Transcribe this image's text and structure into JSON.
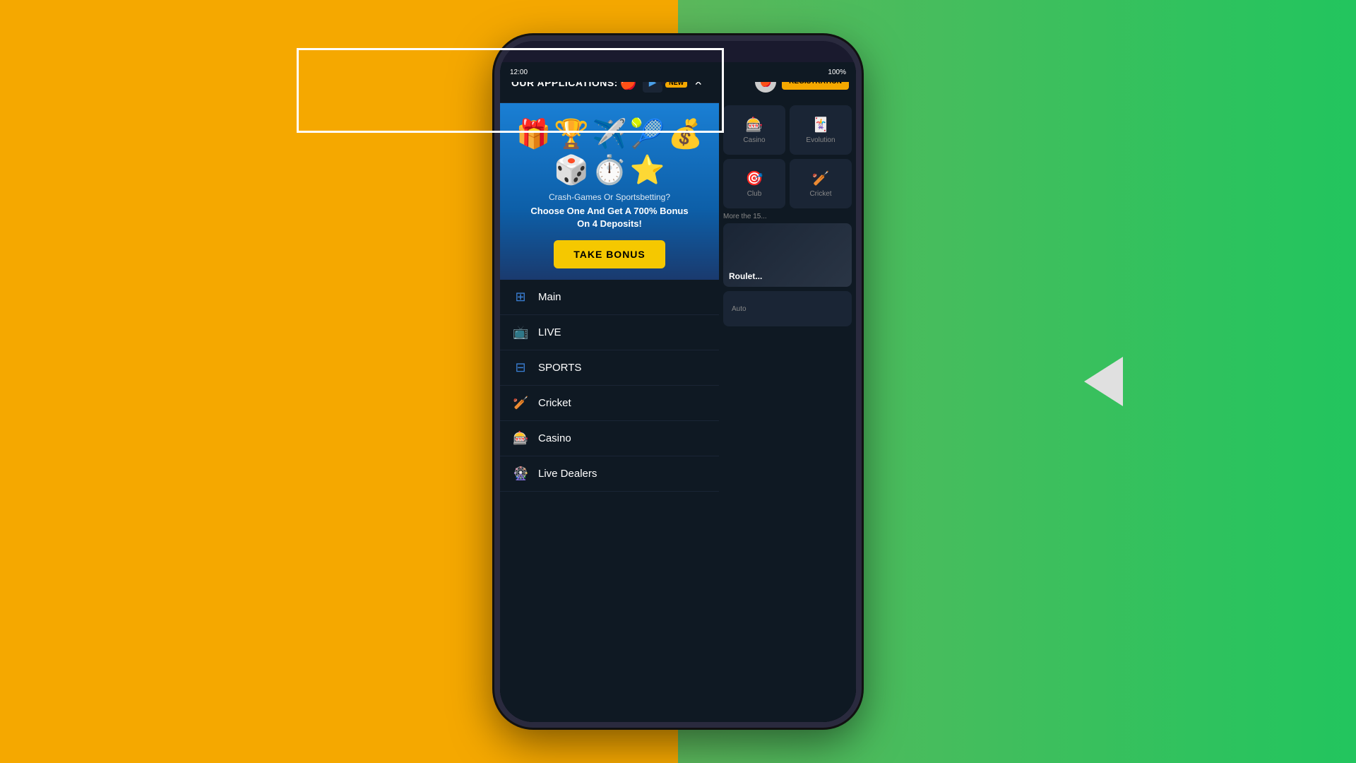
{
  "background": {
    "left_color": "#f5a800",
    "right_color": "#22c55e"
  },
  "phone": {
    "status_bar": {
      "time": "12:00",
      "battery": "100%"
    }
  },
  "popup": {
    "header": {
      "title": "OUR APPLICATIONS:",
      "close_label": "×"
    },
    "apps": {
      "apple_icon": "🍎",
      "new_badge_label": "NEW",
      "android_icon": "▶"
    },
    "banner": {
      "subtitle": "Crash-Games Or Sportsbetting?",
      "title": "Choose One And Get A 700% Bonus\nOn 4 Deposits!",
      "button_label": "TAKE BONUS",
      "emojis": [
        "🎁",
        "🏆",
        "✈️",
        "🎾",
        "💰",
        "🎲",
        "⏰",
        "⭐"
      ]
    },
    "menu": [
      {
        "id": "main",
        "label": "Main",
        "icon": "⊞"
      },
      {
        "id": "live",
        "label": "LIVE",
        "icon": "📺"
      },
      {
        "id": "sports",
        "label": "SPORTS",
        "icon": "⊟"
      },
      {
        "id": "cricket",
        "label": "Cricket",
        "icon": "🏏"
      },
      {
        "id": "casino",
        "label": "Casino",
        "icon": "🎰"
      },
      {
        "id": "live-dealers",
        "label": "Live Dealers",
        "icon": "🎡"
      }
    ]
  },
  "right_panel": {
    "registration_label": "REGISTRATION",
    "cards": [
      {
        "label": "Casino",
        "icon": "🎰"
      },
      {
        "label": "Evolution",
        "icon": "🃏"
      },
      {
        "label": "Club",
        "icon": "🎯"
      },
      {
        "label": "Cricket",
        "icon": "🏏"
      }
    ],
    "large_card_label": "More the 15...",
    "roulette_label": "Roulet",
    "auto_label": "Auto"
  },
  "highlight_rect": {
    "visible": true
  },
  "back_arrow": {
    "visible": true
  }
}
